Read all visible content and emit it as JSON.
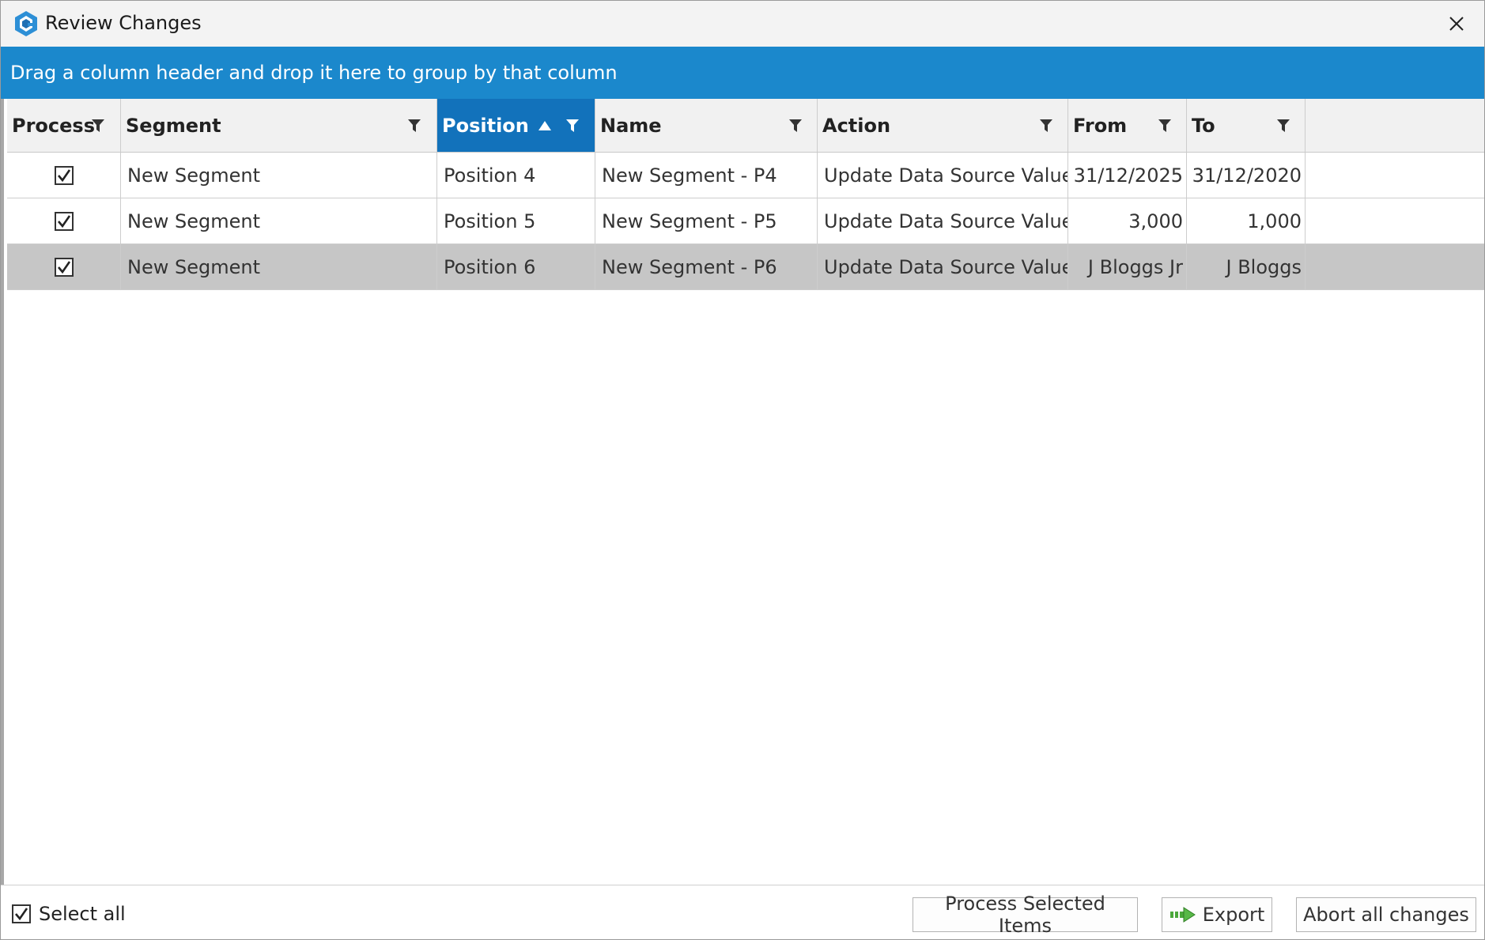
{
  "window": {
    "title": "Review Changes",
    "app_icon": "app-logo-icon",
    "close_icon": "close-icon"
  },
  "group_panel": {
    "text": "Drag a column header and drop it here to group by that column"
  },
  "columns": [
    {
      "label": "Process",
      "filter": true,
      "sorted": false
    },
    {
      "label": "Segment",
      "filter": true,
      "sorted": false
    },
    {
      "label": "Position",
      "filter": true,
      "sorted": true,
      "sort_direction": "ascending"
    },
    {
      "label": "Name",
      "filter": true,
      "sorted": false
    },
    {
      "label": "Action",
      "filter": true,
      "sorted": false
    },
    {
      "label": "From",
      "filter": true,
      "sorted": false
    },
    {
      "label": "To",
      "filter": true,
      "sorted": false
    }
  ],
  "rows": [
    {
      "process": true,
      "segment": "New Segment",
      "position": "Position 4",
      "name": "New Segment - P4",
      "action": "Update Data Source Value",
      "from": "31/12/2025",
      "to": "31/12/2020",
      "selected": false
    },
    {
      "process": true,
      "segment": "New Segment",
      "position": "Position 5",
      "name": "New Segment - P5",
      "action": "Update Data Source Value",
      "from": "3,000",
      "to": "1,000",
      "selected": false
    },
    {
      "process": true,
      "segment": "New Segment",
      "position": "Position 6",
      "name": "New Segment - P6",
      "action": "Update Data Source Value",
      "from": "J Bloggs Jr",
      "to": "J Bloggs",
      "selected": true
    }
  ],
  "footer": {
    "select_all_label": "Select all",
    "select_all_checked": true,
    "process_button": "Process Selected Items",
    "export_button": "Export",
    "export_icon": "export-arrow-icon",
    "abort_button": "Abort all changes"
  },
  "colors": {
    "group_panel_bg": "#1b88cc",
    "sorted_header_bg": "#1272bb",
    "selected_row_bg": "#c6c6c6",
    "titlebar_bg": "#f3f3f3"
  }
}
